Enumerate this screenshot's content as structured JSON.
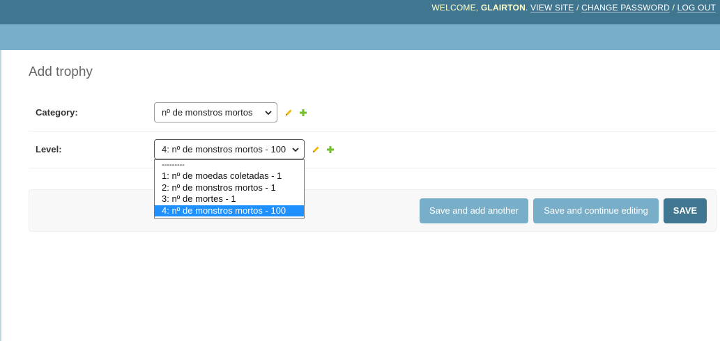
{
  "header": {
    "welcome": "WELCOME,",
    "username": "GLAIRTON",
    "period": ".",
    "view_site": "VIEW SITE",
    "sep1": "/",
    "change_password": "CHANGE PASSWORD",
    "sep2": "/",
    "log_out": "LOG OUT"
  },
  "page": {
    "title": "Add trophy"
  },
  "form": {
    "category": {
      "label": "Category:",
      "selected": "nº de monstros mortos"
    },
    "level": {
      "label": "Level:",
      "selected": "4: nº de monstros mortos - 100",
      "options": [
        "---------",
        "1: nº de moedas coletadas - 1",
        "2: nº de monstros mortos - 1",
        "3: nº de mortes - 1",
        "4: nº de monstros mortos - 100"
      ],
      "selected_index": 4
    }
  },
  "buttons": {
    "save_add_another": "Save and add another",
    "save_continue": "Save and continue editing",
    "save": "SAVE"
  },
  "colors": {
    "header_bg": "#417690",
    "breadcrumb_bg": "#79aec8",
    "button_light": "#79aec8",
    "button_primary": "#417690",
    "pencil": "#efb80b",
    "plus": "#70bf2b",
    "highlight": "#1e90ff"
  },
  "icons": [
    "pencil-icon",
    "plus-icon",
    "chevron-down-icon"
  ]
}
